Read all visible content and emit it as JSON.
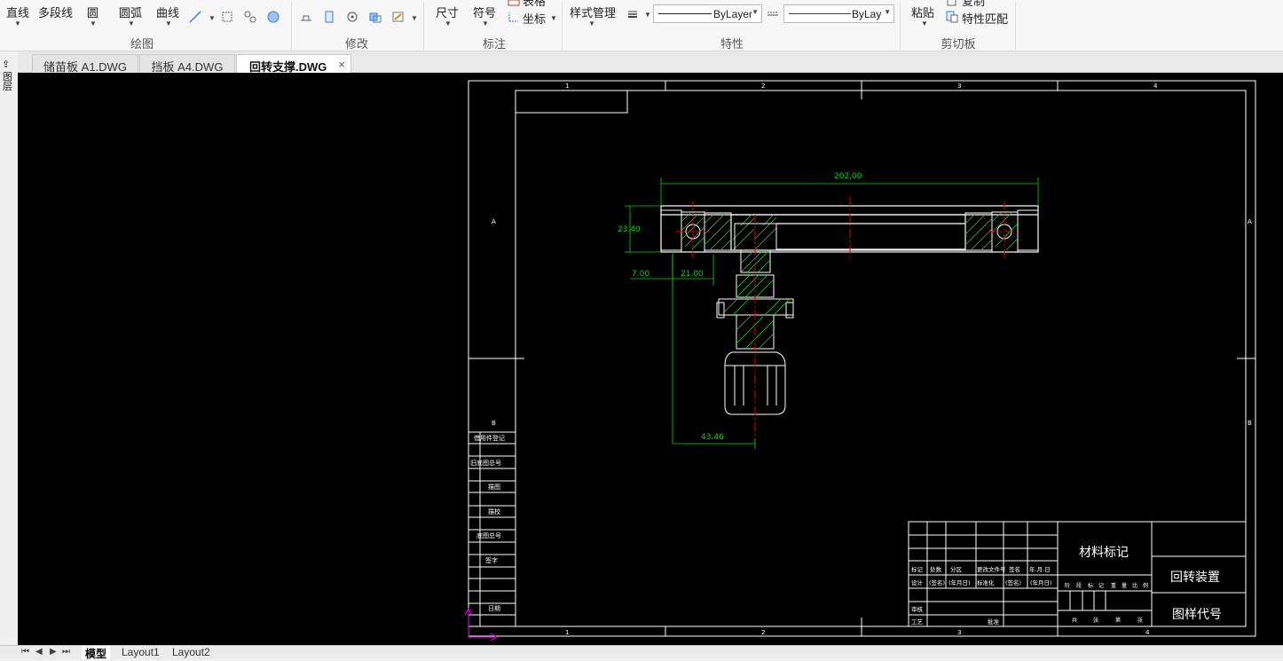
{
  "ribbon": {
    "draw": {
      "line": "直线",
      "polyline": "多段线",
      "circle": "圆",
      "arc": "圆弧",
      "curve": "曲线",
      "group_label": "绘图"
    },
    "modify": {
      "group_label": "修改"
    },
    "annotate": {
      "dimension": "尺寸",
      "symbol": "符号",
      "table": "表格",
      "coordinate": "坐标",
      "group_label": "标注"
    },
    "properties": {
      "style_manager": "样式管理",
      "linetype_value": "ByLayer",
      "color_value": "ByLayer",
      "group_label": "特性"
    },
    "clipboard": {
      "paste": "粘贴",
      "copy": "复制",
      "match_properties": "特性匹配",
      "group_label": "剪切板"
    }
  },
  "document_tabs": [
    {
      "label": "储苗板 A1.DWG",
      "active": false
    },
    {
      "label": "挡板 A4.DWG",
      "active": false
    },
    {
      "label": "回转支撑.DWG",
      "active": true,
      "close": "×"
    }
  ],
  "left_strip": {
    "label": "图层"
  },
  "drawing": {
    "dimensions": {
      "overall_width": "202.00",
      "height": "23.40",
      "offset_left": "7.00",
      "offset_inner": "21.00",
      "motor_offset": "43.46"
    },
    "frame": {
      "col_markers": [
        "1",
        "2",
        "3",
        "4"
      ],
      "row_markers": [
        "A",
        "B"
      ],
      "side_table": [
        "借用件登记",
        "旧底图总号",
        "描图",
        "描校",
        "底图总号",
        "签字",
        "日期"
      ]
    },
    "title_block": {
      "material": "材料标记",
      "part_name": "回转装置",
      "drawing_code": "图样代号",
      "row1": [
        "标记",
        "处数",
        "分区",
        "更改文件号",
        "签名",
        "年.月.日"
      ],
      "row2": [
        "设计",
        "(签名)",
        "(年月日)",
        "标准化",
        "(签名)",
        "(年月日)"
      ],
      "row3": [
        "审核"
      ],
      "row4": [
        "工艺",
        "批准"
      ],
      "stage_labels": [
        "阶",
        "段",
        "标",
        "记",
        "重",
        "量",
        "比",
        "例"
      ],
      "sheet_labels": [
        "共",
        "张",
        "第",
        "张"
      ]
    }
  },
  "layout_tabs": [
    "模型",
    "Layout1",
    "Layout2"
  ],
  "colors": {
    "canvas_bg": "#000000",
    "frame_line": "#ffffff",
    "dimension_green": "#00d800",
    "centerline_red": "#e00000",
    "ucs_magenta": "#d000d0"
  }
}
